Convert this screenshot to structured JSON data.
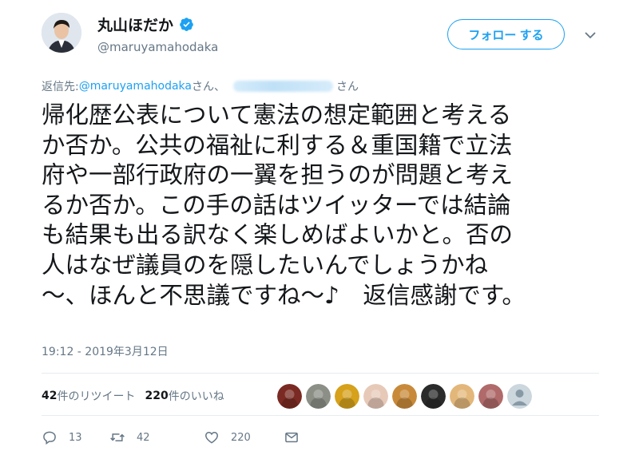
{
  "profile": {
    "display_name": "丸山ほだか",
    "handle": "@maruyamahodaka",
    "verified": true
  },
  "follow_button": {
    "label": "フォロー する"
  },
  "reply": {
    "prefix": "返信先: ",
    "first_handle": "@maruyamahodaka",
    "san1": "さん、",
    "san2": "さん"
  },
  "tweet": {
    "lines": [
      "帰化歴公表について憲法の想定範囲と考える",
      "か否か。公共の福祉に利する＆重国籍で立法",
      "府や一部行政府の一翼を担うのが問題と考え",
      "るか否か。この手の話はツイッターでは結論",
      "も結果も出る訳なく楽しめばよいかと。否の",
      "人はなぜ議員のを隠したいんでしょうかね",
      "～、ほんと不思議ですね～♪　返信感謝です。"
    ],
    "timestamp": "19:12 - 2019年3月12日"
  },
  "stats": {
    "retweets_count": "42",
    "retweets_label": "件のリツイート",
    "likes_count": "220",
    "likes_label": "件のいいね"
  },
  "likers": [
    {
      "icon": "liker-avatar-red-bird",
      "color": "#7a2a22"
    },
    {
      "icon": "liker-avatar-wolf",
      "color": "#8b8f86"
    },
    {
      "icon": "liker-avatar-gold",
      "color": "#d6a11b"
    },
    {
      "icon": "liker-avatar-girl",
      "color": "#e7c9b8"
    },
    {
      "icon": "liker-avatar-food",
      "color": "#c88a3a"
    },
    {
      "icon": "liker-avatar-mustache",
      "color": "#2b2b2b"
    },
    {
      "icon": "liker-avatar-people",
      "color": "#e3b77a"
    },
    {
      "icon": "liker-avatar-anime",
      "color": "#b06a6a"
    },
    {
      "icon": "liker-avatar-default",
      "color": "#ccd6dd"
    }
  ],
  "actions": {
    "reply_count": "13",
    "retweet_count": "42",
    "like_count": "220"
  },
  "colors": {
    "accent": "#1da1f2",
    "secondary_text": "#657786",
    "primary_text": "#14171a",
    "divider": "#e6ecf0"
  }
}
